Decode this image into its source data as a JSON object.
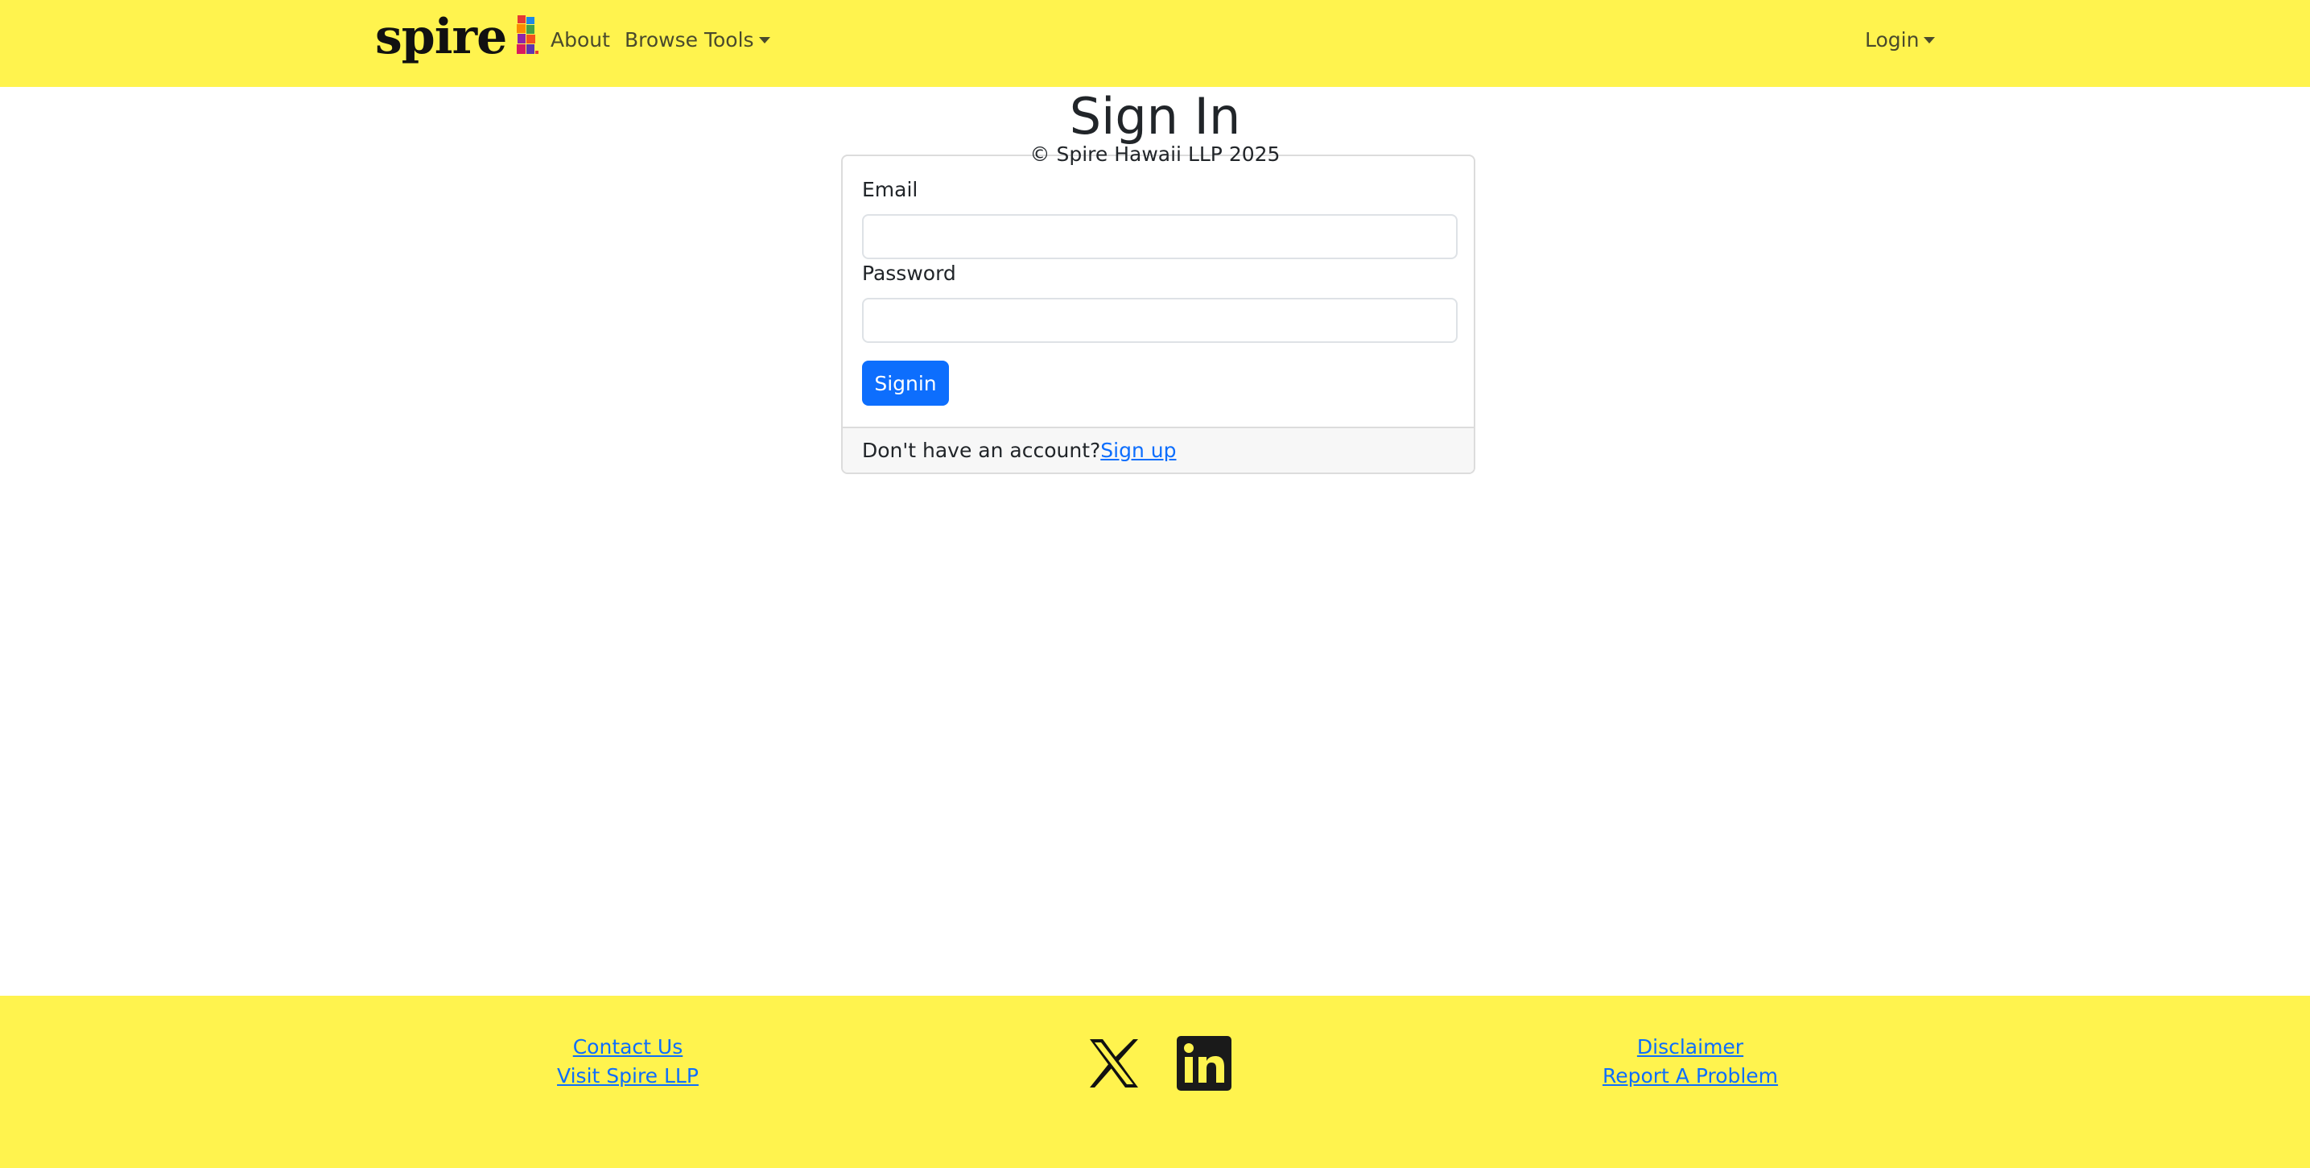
{
  "navbar": {
    "brand": "spire",
    "links": {
      "about": "About",
      "browse_tools": "Browse Tools",
      "login": "Login"
    }
  },
  "main": {
    "title": "Sign In",
    "form": {
      "email_label": "Email",
      "email_value": "",
      "password_label": "Password",
      "password_value": "",
      "submit_label": "Signin"
    },
    "footer_prompt": "Don't have an account?",
    "signup_link": "Sign up"
  },
  "footer": {
    "left_links": [
      "Contact Us",
      "Visit Spire LLP"
    ],
    "right_links": [
      "Disclaimer",
      "Report A Problem"
    ],
    "social_icons": [
      "x-icon",
      "linkedin-icon"
    ],
    "copyright": "© Spire Hawaii LLP 2025"
  },
  "colors": {
    "brand_yellow": "#fff34e",
    "primary": "#0d6efd",
    "text": "#212529"
  }
}
